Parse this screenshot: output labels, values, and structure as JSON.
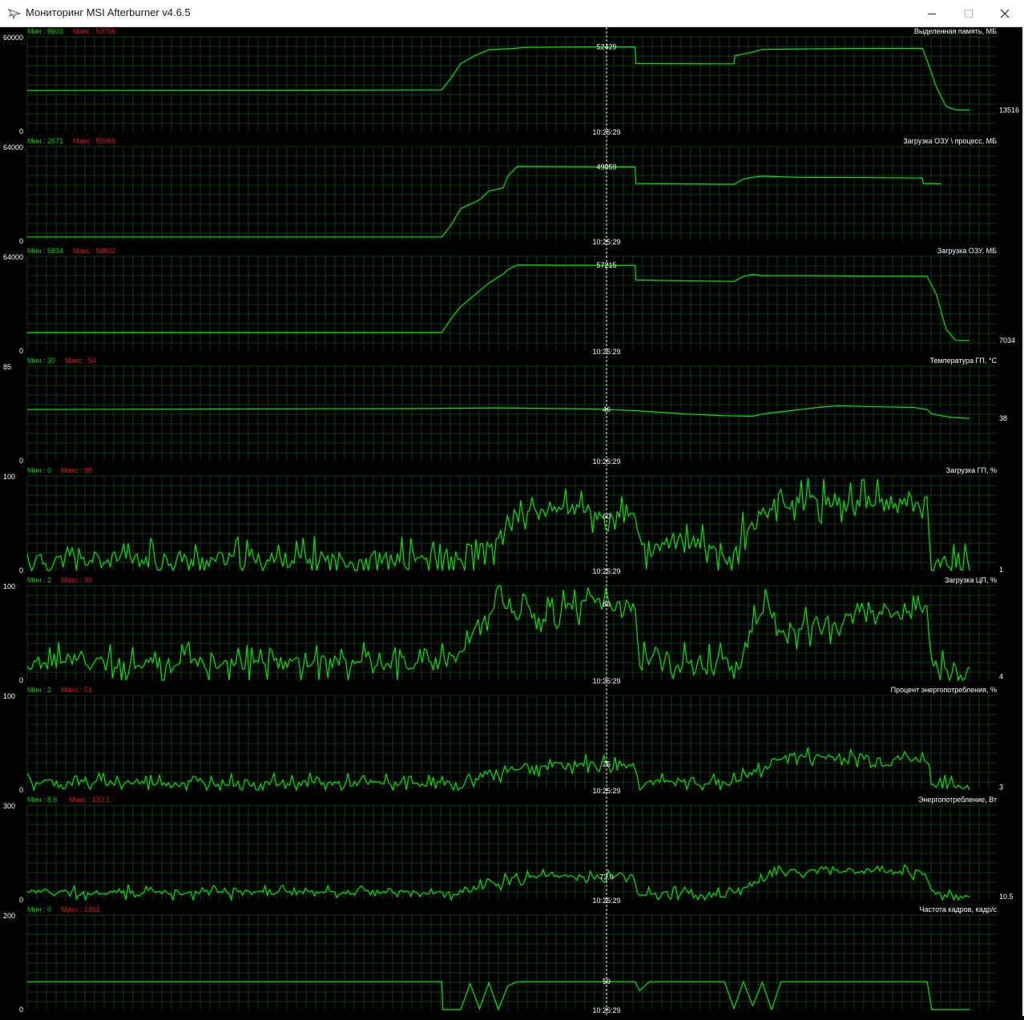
{
  "window": {
    "title": "Мониторинг MSI Afterburner v4.6.5",
    "icons": {
      "app": "afterburner-plane-icon",
      "minimize": "minimize-icon",
      "maximize": "maximize-icon",
      "close": "close-icon"
    }
  },
  "colors": {
    "background": "#000000",
    "grid": "#0d3b10",
    "line": "#00e800",
    "min_label": "#00d000",
    "max_label": "#e01818",
    "text": "#ffffff",
    "cursor": "#ffffff"
  },
  "cursor": {
    "time": "10:25:29"
  },
  "panels": [
    {
      "name": "Выделенная память, МБ",
      "min_label": "Мин : 8603",
      "max_label": "Макс : 53756",
      "y_top": "60000",
      "y_bottom": "0",
      "y_max": 60000,
      "cursor_value": "52429",
      "last_value": "13516",
      "series": [
        [
          0,
          26000
        ],
        [
          0.3,
          26200
        ],
        [
          0.44,
          26400
        ],
        [
          0.45,
          34000
        ],
        [
          0.46,
          43000
        ],
        [
          0.475,
          48000
        ],
        [
          0.49,
          51800
        ],
        [
          0.51,
          52400
        ],
        [
          0.53,
          53300
        ],
        [
          0.56,
          53500
        ],
        [
          0.6,
          53600
        ],
        [
          0.645,
          53600
        ],
        [
          0.646,
          43000
        ],
        [
          0.75,
          42800
        ],
        [
          0.751,
          48000
        ],
        [
          0.77,
          50400
        ],
        [
          0.78,
          52000
        ],
        [
          0.82,
          52300
        ],
        [
          0.9,
          52700
        ],
        [
          0.95,
          52700
        ],
        [
          0.955,
          45000
        ],
        [
          0.965,
          28000
        ],
        [
          0.975,
          16000
        ],
        [
          0.985,
          13700
        ],
        [
          1,
          13516
        ]
      ]
    },
    {
      "name": "Загрузка ОЗУ \\ процесс, МБ",
      "min_label": "Мин : 2671",
      "max_label": "Макс : 50960",
      "y_top": "64000",
      "y_bottom": "0",
      "y_max": 64000,
      "cursor_value": "49059",
      "last_value": "",
      "series": [
        [
          0,
          2800
        ],
        [
          0.44,
          2800
        ],
        [
          0.45,
          11000
        ],
        [
          0.46,
          22000
        ],
        [
          0.47,
          25000
        ],
        [
          0.48,
          28000
        ],
        [
          0.49,
          34000
        ],
        [
          0.505,
          36000
        ],
        [
          0.51,
          44000
        ],
        [
          0.52,
          50500
        ],
        [
          0.6,
          50300
        ],
        [
          0.645,
          50200
        ],
        [
          0.646,
          39000
        ],
        [
          0.75,
          38500
        ],
        [
          0.76,
          42000
        ],
        [
          0.77,
          43200
        ],
        [
          0.78,
          44000
        ],
        [
          0.82,
          43200
        ],
        [
          0.9,
          43000
        ],
        [
          0.95,
          42800
        ],
        [
          0.951,
          39000
        ],
        [
          0.97,
          38800
        ]
      ]
    },
    {
      "name": "Загрузка ОЗУ, МБ",
      "min_label": "Мин : 5834",
      "max_label": "Макс : 58832",
      "y_top": "64000",
      "y_bottom": "0",
      "y_max": 64000,
      "cursor_value": "57215",
      "last_value": "7034",
      "series": [
        [
          0,
          12500
        ],
        [
          0.44,
          12500
        ],
        [
          0.45,
          22000
        ],
        [
          0.46,
          30000
        ],
        [
          0.475,
          38000
        ],
        [
          0.49,
          46000
        ],
        [
          0.505,
          52000
        ],
        [
          0.51,
          55000
        ],
        [
          0.52,
          58200
        ],
        [
          0.6,
          58000
        ],
        [
          0.645,
          57900
        ],
        [
          0.646,
          48000
        ],
        [
          0.75,
          47000
        ],
        [
          0.76,
          50500
        ],
        [
          0.77,
          51800
        ],
        [
          0.78,
          51000
        ],
        [
          0.82,
          51000
        ],
        [
          0.9,
          50600
        ],
        [
          0.955,
          50500
        ],
        [
          0.965,
          38000
        ],
        [
          0.975,
          15000
        ],
        [
          0.985,
          7200
        ],
        [
          1,
          7034
        ]
      ]
    },
    {
      "name": "Температура ГП, °C",
      "min_label": "Мин : 30",
      "max_label": "Макс : 54",
      "y_top": "85",
      "y_bottom": "0",
      "y_max": 85,
      "cursor_value": "46",
      "last_value": "38",
      "series": [
        [
          0,
          46
        ],
        [
          0.2,
          46.5
        ],
        [
          0.4,
          46.8
        ],
        [
          0.5,
          47.5
        ],
        [
          0.6,
          46.5
        ],
        [
          0.645,
          45
        ],
        [
          0.7,
          42
        ],
        [
          0.74,
          40.5
        ],
        [
          0.77,
          40
        ],
        [
          0.78,
          42
        ],
        [
          0.8,
          44
        ],
        [
          0.84,
          48
        ],
        [
          0.86,
          49.5
        ],
        [
          0.9,
          48.5
        ],
        [
          0.94,
          48
        ],
        [
          0.955,
          46
        ],
        [
          0.96,
          42
        ],
        [
          0.98,
          39
        ],
        [
          1,
          38
        ]
      ]
    },
    {
      "name": "Загрузка ГП, %",
      "min_label": "Мин : 0",
      "max_label": "Макс : 88",
      "y_top": "100",
      "y_bottom": "0",
      "y_max": 100,
      "cursor_value": "60",
      "last_value": "1",
      "series": [
        [
          0,
          10
        ],
        [
          0.44,
          12
        ],
        [
          0.46,
          5
        ],
        [
          0.48,
          20
        ],
        [
          0.5,
          30
        ],
        [
          0.51,
          55
        ],
        [
          0.54,
          62
        ],
        [
          0.57,
          68
        ],
        [
          0.6,
          58
        ],
        [
          0.645,
          55
        ],
        [
          0.66,
          5
        ],
        [
          0.67,
          28
        ],
        [
          0.72,
          26
        ],
        [
          0.73,
          25
        ],
        [
          0.74,
          5
        ],
        [
          0.76,
          40
        ],
        [
          0.79,
          70
        ],
        [
          0.86,
          75
        ],
        [
          0.93,
          70
        ],
        [
          0.955,
          72
        ],
        [
          0.96,
          10
        ],
        [
          0.99,
          5
        ],
        [
          1,
          1
        ]
      ],
      "noise": {
        "seed": 11,
        "amp": 16
      }
    },
    {
      "name": "Загрузка ЦП, %",
      "min_label": "Мин : 2",
      "max_label": "Макс : 99",
      "y_top": "100",
      "y_bottom": "0",
      "y_max": 100,
      "cursor_value": "86",
      "last_value": "4",
      "series": [
        [
          0,
          18
        ],
        [
          0.44,
          18
        ],
        [
          0.46,
          30
        ],
        [
          0.48,
          55
        ],
        [
          0.5,
          80
        ],
        [
          0.52,
          70
        ],
        [
          0.56,
          72
        ],
        [
          0.6,
          82
        ],
        [
          0.645,
          78
        ],
        [
          0.65,
          20
        ],
        [
          0.75,
          18
        ],
        [
          0.76,
          30
        ],
        [
          0.78,
          80
        ],
        [
          0.8,
          52
        ],
        [
          0.85,
          60
        ],
        [
          0.9,
          70
        ],
        [
          0.955,
          72
        ],
        [
          0.96,
          18
        ],
        [
          0.99,
          8
        ],
        [
          1,
          4
        ]
      ],
      "noise": {
        "seed": 27,
        "amp": 14
      }
    },
    {
      "name": "Процент энергопотребления, %",
      "min_label": "Мин : 2",
      "max_label": "Макс : 51",
      "y_top": "100",
      "y_bottom": "0",
      "y_max": 100,
      "cursor_value": "25",
      "last_value": "3",
      "series": [
        [
          0,
          8
        ],
        [
          0.44,
          7
        ],
        [
          0.46,
          4
        ],
        [
          0.48,
          14
        ],
        [
          0.5,
          18
        ],
        [
          0.52,
          24
        ],
        [
          0.6,
          28
        ],
        [
          0.645,
          26
        ],
        [
          0.65,
          8
        ],
        [
          0.75,
          8
        ],
        [
          0.76,
          14
        ],
        [
          0.78,
          22
        ],
        [
          0.8,
          36
        ],
        [
          0.86,
          34
        ],
        [
          0.93,
          33
        ],
        [
          0.955,
          32
        ],
        [
          0.96,
          6
        ],
        [
          0.99,
          4
        ],
        [
          1,
          3
        ]
      ],
      "noise": {
        "seed": 43,
        "amp": 7
      }
    },
    {
      "name": "Энергопотребление, Вт",
      "min_label": "Мин : 8.6",
      "max_label": "Макс : 133.1",
      "y_top": "300",
      "y_bottom": "0",
      "y_max": 300,
      "cursor_value": "73.0",
      "last_value": "10.5",
      "series": [
        [
          0,
          24
        ],
        [
          0.44,
          22
        ],
        [
          0.46,
          14
        ],
        [
          0.48,
          40
        ],
        [
          0.5,
          52
        ],
        [
          0.52,
          70
        ],
        [
          0.6,
          73
        ],
        [
          0.645,
          72
        ],
        [
          0.65,
          20
        ],
        [
          0.75,
          18
        ],
        [
          0.76,
          40
        ],
        [
          0.78,
          60
        ],
        [
          0.8,
          90
        ],
        [
          0.86,
          92
        ],
        [
          0.93,
          88
        ],
        [
          0.955,
          86
        ],
        [
          0.96,
          20
        ],
        [
          0.99,
          12
        ],
        [
          1,
          10.5
        ]
      ],
      "noise": {
        "seed": 59,
        "amp": 16
      }
    },
    {
      "name": "Частота кадров, кадр/с",
      "min_label": "Мин : 0",
      "max_label": "Макс : 1951",
      "y_top": "200",
      "y_bottom": "0",
      "y_max": 200,
      "cursor_value": "59",
      "last_value": "",
      "series": [
        [
          0,
          59
        ],
        [
          0.44,
          59
        ],
        [
          0.441,
          0
        ],
        [
          0.46,
          0
        ],
        [
          0.47,
          55
        ],
        [
          0.48,
          2
        ],
        [
          0.49,
          57
        ],
        [
          0.5,
          0
        ],
        [
          0.51,
          50
        ],
        [
          0.52,
          59
        ],
        [
          0.645,
          59
        ],
        [
          0.65,
          40
        ],
        [
          0.66,
          59
        ],
        [
          0.74,
          59
        ],
        [
          0.75,
          2
        ],
        [
          0.76,
          59
        ],
        [
          0.77,
          8
        ],
        [
          0.78,
          58
        ],
        [
          0.79,
          0
        ],
        [
          0.8,
          59
        ],
        [
          0.955,
          59
        ],
        [
          0.96,
          0
        ],
        [
          0.99,
          0
        ],
        [
          1,
          0
        ]
      ]
    }
  ]
}
